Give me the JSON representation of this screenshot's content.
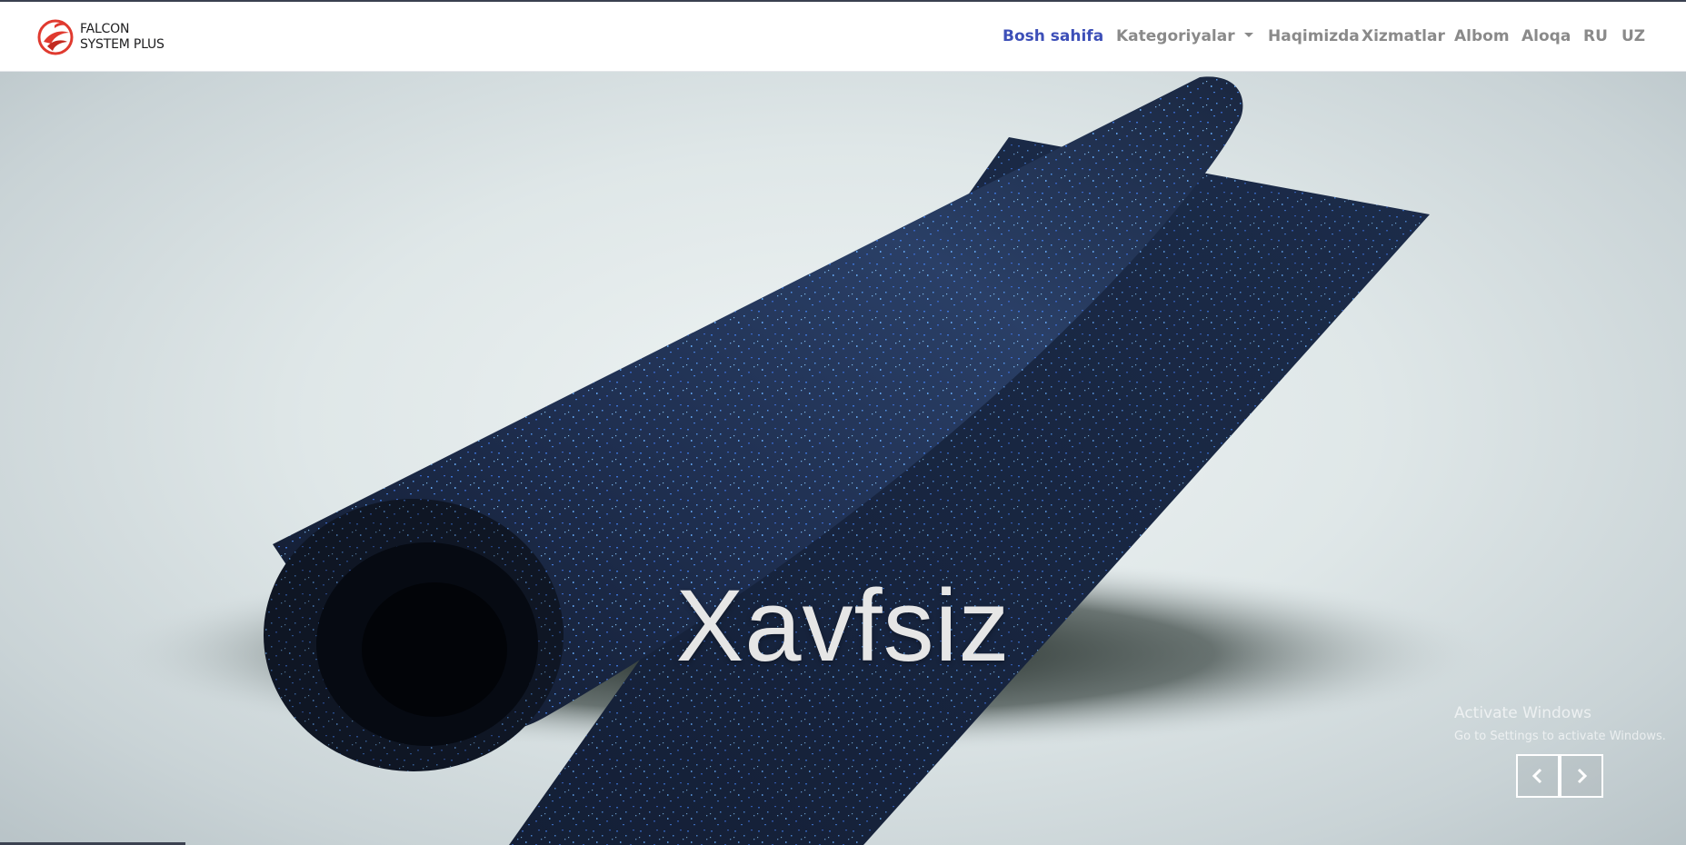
{
  "brand": {
    "line1": "FALCON",
    "line2": "SYSTEM PLUS",
    "logo_icon": "falcon-swirl-logo",
    "logo_color": "#e03a2f"
  },
  "nav": {
    "home": "Bosh sahifa",
    "categories": "Kategoriyalar",
    "about": "Haqimizda",
    "services": "Xizmatlar",
    "album": "Albom",
    "contact": "Aloqa",
    "lang_ru": "RU",
    "lang_uz": "UZ",
    "active_color": "#3d4fb8",
    "link_color": "#8a8a8a"
  },
  "hero": {
    "caption": "Xavfsiz",
    "prev_icon": "chevron-left-icon",
    "next_icon": "chevron-right-icon"
  },
  "watermark": {
    "line1": "Activate Windows",
    "line2": "Go to Settings to activate Windows."
  }
}
